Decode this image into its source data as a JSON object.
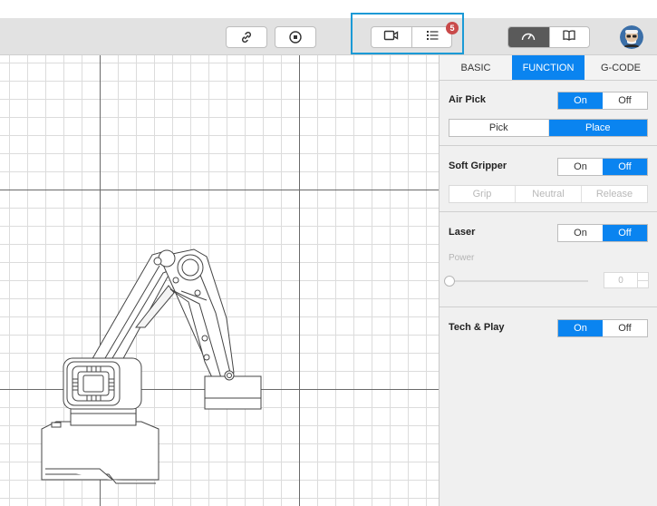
{
  "toolbar": {
    "link_icon": "link-icon",
    "stop_icon": "stop-record-icon",
    "camera_icon": "video-camera-icon",
    "list_icon": "list-icon",
    "list_badge": "5",
    "speed_icon": "speedometer-icon",
    "book_icon": "book-icon",
    "avatar_icon": "user-avatar"
  },
  "colors": {
    "accent": "#0a84f0",
    "highlight": "#1b9ad6",
    "badge": "#c94a4a"
  },
  "tabs": [
    {
      "label": "BASIC",
      "active": false
    },
    {
      "label": "FUNCTION",
      "active": true
    },
    {
      "label": "G-CODE",
      "active": false
    }
  ],
  "air_pick": {
    "title": "Air Pick",
    "toggle": {
      "on": "On",
      "off": "Off",
      "selected": "On"
    },
    "modes": {
      "pick": "Pick",
      "place": "Place",
      "selected": "Place"
    }
  },
  "soft_gripper": {
    "title": "Soft Gripper",
    "toggle": {
      "on": "On",
      "off": "Off",
      "selected": "Off"
    },
    "modes": {
      "grip": "Grip",
      "neutral": "Neutral",
      "release": "Release"
    }
  },
  "laser": {
    "title": "Laser",
    "toggle": {
      "on": "On",
      "off": "Off",
      "selected": "Off"
    },
    "power_label": "Power",
    "power_value": "0",
    "power_level": 0
  },
  "tech_play": {
    "title": "Tech & Play",
    "toggle": {
      "on": "On",
      "off": "Off",
      "selected": "On"
    }
  }
}
